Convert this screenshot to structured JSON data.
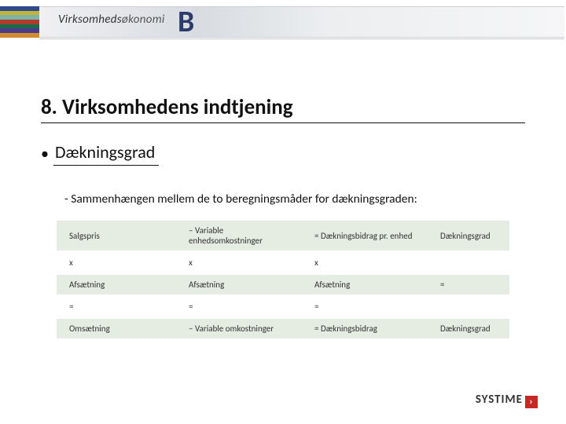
{
  "banner": {
    "brand_prefix": "Virksomheds",
    "brand_suffix": "økonomi",
    "level": "B"
  },
  "title": "8. Virksomhedens indtjening",
  "bullet": "Dækningsgrad",
  "subtext": "- Sammenhængen mellem de to beregningsmåder for dækningsgraden:",
  "table": {
    "rows": [
      {
        "c1": "Salgspris",
        "c2": "– Variable enhedsomkostninger",
        "c3": "= Dækningsbidrag pr. enhed",
        "c4": "Dækningsgrad"
      },
      {
        "c1": "x",
        "c2": "x",
        "c3": "x",
        "c4": ""
      },
      {
        "c1": "Afsætning",
        "c2": "Afsætning",
        "c3": "Afsætning",
        "c4": "="
      },
      {
        "c1": "=",
        "c2": "=",
        "c3": "=",
        "c4": ""
      },
      {
        "c1": "Omsætning",
        "c2": "– Variable omkostninger",
        "c3": "= Dækningsbidrag",
        "c4": "Dækningsgrad"
      }
    ]
  },
  "footer": {
    "logo": "SYSTIME",
    "chevron": "›"
  }
}
